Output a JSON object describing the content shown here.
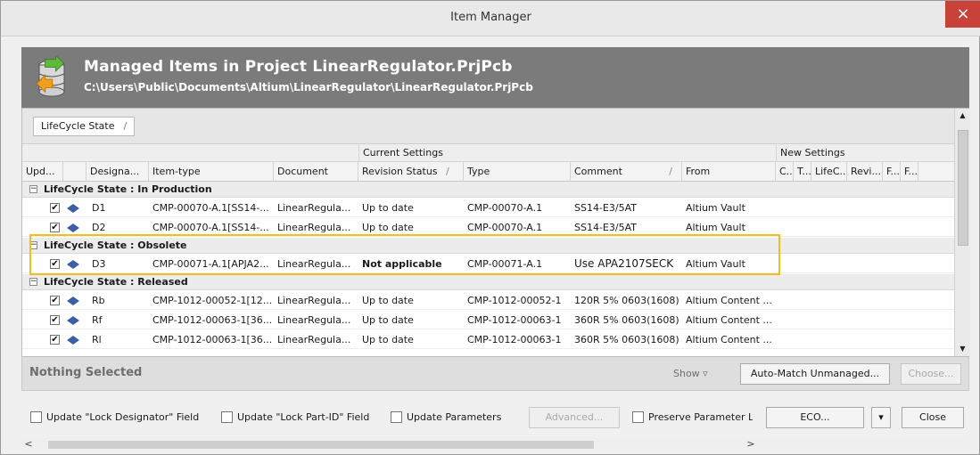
{
  "window": {
    "title": "Item Manager",
    "close_glyph": "×"
  },
  "banner": {
    "title": "Managed Items in Project LinearRegulator.PrjPcb",
    "path": "C:\\Users\\Public\\Documents\\Altium\\LinearRegulator\\LinearRegulator.PrjPcb",
    "icon": "database-arrow-icon"
  },
  "grouping": {
    "chip_label": "LifeCycle State",
    "sort_glyph": "/"
  },
  "super_headers": {
    "current": "Current Settings",
    "new": "New Settings"
  },
  "columns": [
    "Upd...",
    "Designa...",
    "Item-type",
    "Document",
    "Revision Status",
    "Type",
    "Comment",
    "From",
    "C...",
    "T...",
    "LifeC...",
    "Revi...",
    "F...",
    "F..."
  ],
  "column_sort_glyphs": {
    "revision": "/",
    "comment": "/"
  },
  "groups": [
    {
      "label": "LifeCycle State : In Production",
      "toggle": "−",
      "rows": [
        {
          "checked": "✔",
          "designator": "D1",
          "item_type": "CMP-00070-A.1[SS14-...",
          "document": "LinearRegula...",
          "revision_status": "Up to date",
          "type": "CMP-00070-A.1",
          "comment": "SS14-E3/5AT",
          "from": "Altium Vault"
        },
        {
          "checked": "✔",
          "designator": "D2",
          "item_type": "CMP-00070-A.1[SS14-...",
          "document": "LinearRegula...",
          "revision_status": "Up to date",
          "type": "CMP-00070-A.1",
          "comment": "SS14-E3/5AT",
          "from": "Altium Vault"
        }
      ]
    },
    {
      "label": "LifeCycle State : Obsolete",
      "toggle": "−",
      "rows": [
        {
          "checked": "✔",
          "designator": "D3",
          "item_type": "CMP-00071-A.1[APJA2...",
          "document": "LinearRegula...",
          "revision_status": "Not applicable",
          "type": "CMP-00071-A.1",
          "comment": "Use APA2107SECK",
          "from": "Altium Vault"
        }
      ]
    },
    {
      "label": "LifeCycle State : Released",
      "toggle": "−",
      "rows": [
        {
          "checked": "✔",
          "designator": "Rb",
          "item_type": "CMP-1012-00052-1[12...",
          "document": "LinearRegula...",
          "revision_status": "Up to date",
          "type": "CMP-1012-00052-1",
          "comment": "120R 5% 0603(1608)",
          "from": "Altium Content ..."
        },
        {
          "checked": "✔",
          "designator": "Rf",
          "item_type": "CMP-1012-00063-1[36...",
          "document": "LinearRegula...",
          "revision_status": "Up to date",
          "type": "CMP-1012-00063-1",
          "comment": "360R 5% 0603(1608)",
          "from": "Altium Content ..."
        },
        {
          "checked": "✔",
          "designator": "Rl",
          "item_type": "CMP-1012-00063-1[36...",
          "document": "LinearRegula...",
          "revision_status": "Up to date",
          "type": "CMP-1012-00063-1",
          "comment": "360R 5% 0603(1608)",
          "from": "Altium Content ..."
        }
      ]
    }
  ],
  "status": {
    "text": "Nothing Selected",
    "show_label": "Show ▿",
    "auto_match_label": "Auto-Match Unmanaged...",
    "choose_label": "Choose..."
  },
  "options": [
    {
      "label": "Update \"Lock Designator\" Field"
    },
    {
      "label": "Update \"Lock Part-ID\" Field"
    },
    {
      "label": "Update Parameters"
    }
  ],
  "buttons": {
    "advanced": "Advanced...",
    "preserve": "Preserve Parameter Lo",
    "eco": "ECO...",
    "eco_dropdown": "▾",
    "close": "Close"
  },
  "scroll": {
    "up": "▲",
    "down": "▼",
    "left": "<",
    "right": ">"
  },
  "colors": {
    "banner": "#7b7b7b",
    "highlight": "#f2bd1f",
    "close": "#c9423a",
    "part_icon": "#3d5fa8"
  }
}
